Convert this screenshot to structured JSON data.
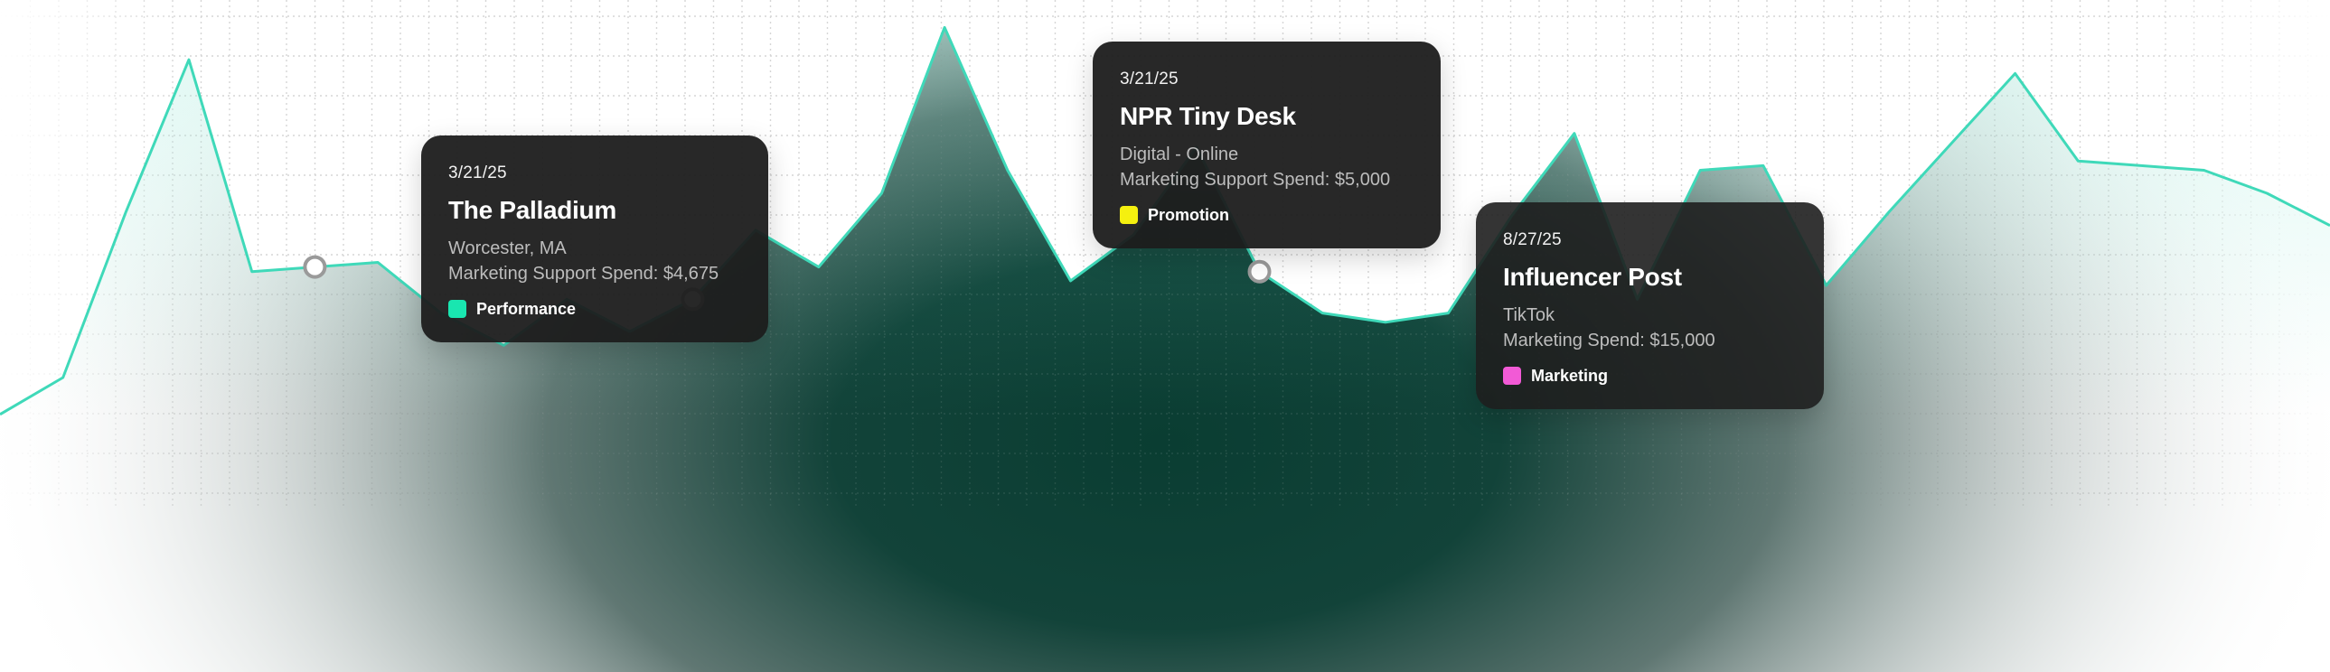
{
  "chart_data": {
    "type": "area",
    "title": "",
    "xlabel": "",
    "ylabel": "",
    "grid": true,
    "legend": "none",
    "ylim": [
      0,
      100
    ],
    "series": [
      {
        "values": [
          12,
          20,
          56,
          89,
          43,
          44,
          45,
          34,
          27,
          37,
          30,
          37,
          52,
          44,
          60,
          96,
          65,
          41,
          51,
          70,
          43,
          34,
          32,
          34,
          55,
          73,
          37,
          65,
          66,
          40,
          56,
          71,
          86,
          67,
          66,
          65,
          60,
          53
        ]
      }
    ],
    "highlighted_points": [
      {
        "index": 5,
        "date": "3/21/25",
        "title": "The Palladium",
        "lines": [
          "Worcester, MA",
          "Marketing Support Spend: $4,675"
        ],
        "tag": "Performance",
        "tag_color": "#19e6b0"
      },
      {
        "index": 11,
        "date": "3/21/25",
        "title": "NPR Tiny Desk",
        "lines": [
          "Digital - Online",
          "Marketing Support Spend: $5,000"
        ],
        "tag": "Promotion",
        "tag_color": "#f5f00f"
      },
      {
        "index": 20,
        "date": "8/27/25",
        "title": "Influencer Post",
        "lines": [
          "TikTok",
          "Marketing Spend: $15,000"
        ],
        "tag": "Marketing",
        "tag_color": "#f25ad6"
      }
    ],
    "colors": {
      "line": "#3fd9b9",
      "area_dark": "#093f33",
      "marker_stroke": "#9a9a9a",
      "marker_fill": "#ffffff",
      "grid": "#d6d6d6",
      "tooltip_bg": "#1c1c1c"
    }
  }
}
